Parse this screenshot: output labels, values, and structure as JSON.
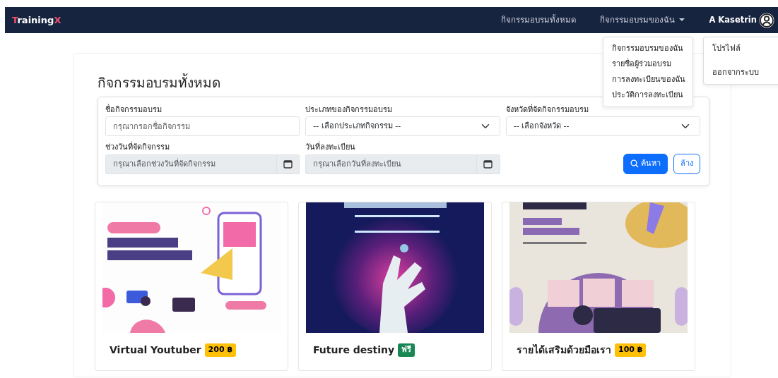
{
  "brand": {
    "parts": [
      {
        "text": "T",
        "color": "#f0506e"
      },
      {
        "text": "raining",
        "color": "#ffffff"
      },
      {
        "text": "X",
        "color": "#f0506e"
      }
    ]
  },
  "nav": {
    "links": [
      {
        "label": "กิจกรรมอบรมทั้งหมด",
        "kind": "link"
      },
      {
        "label": "กิจกรรมอบรมของฉัน",
        "kind": "dropdown",
        "expanded": true,
        "menu": [
          "กิจกรรมอบรมของฉัน",
          "รายชื่อผู้ร่วมอบรม",
          "การลงทะเบียนของฉัน",
          "ประวัติการลงทะเบียน"
        ]
      }
    ],
    "user": {
      "name": "A Kasetrin",
      "expanded": true,
      "menu": [
        "โปรไฟล์",
        "ออกจากระบบ"
      ]
    }
  },
  "page_title": "กิจกรรมอบรมทั้งหมด",
  "filters": [
    {
      "label": "ชื่อกิจกรรมอบรม",
      "kind": "text",
      "placeholder": "กรุณากรอกชื่อกิจกรรม"
    },
    {
      "label": "ประเภทของกิจกรรมอบรม",
      "kind": "select",
      "value": "-- เลือกประเภทกิจกรรม --"
    },
    {
      "label": "จังหวัดที่จัดกิจกรรมอบรม",
      "kind": "select",
      "value": "-- เลือกจังหวัด --"
    },
    {
      "label": "ช่วงวันที่จัดกิจกรรม",
      "kind": "date",
      "placeholder": "กรุณาเลือกช่วงวันที่จัดกิจกรรม"
    },
    {
      "label": "วันที่ลงทะเบียน",
      "kind": "date",
      "placeholder": "กรุณาเลือกวันที่ลงทะเบียน"
    }
  ],
  "buttons": [
    {
      "label": "ค้นหา",
      "kind": "primary"
    },
    {
      "label": "ล้าง",
      "kind": "outline"
    }
  ],
  "cards": [
    {
      "kind": "picture",
      "title": "Virtual Youtuber",
      "price": "200 ฿",
      "color": "#ffc107"
    },
    {
      "kind": "picture",
      "title": "Future destiny",
      "price": "ฟรี",
      "color": "#198754"
    },
    {
      "kind": "picture",
      "title": "รายได้เสริมด้วยมือเรา",
      "price": "100 ฿",
      "color": "#ffc107"
    }
  ]
}
